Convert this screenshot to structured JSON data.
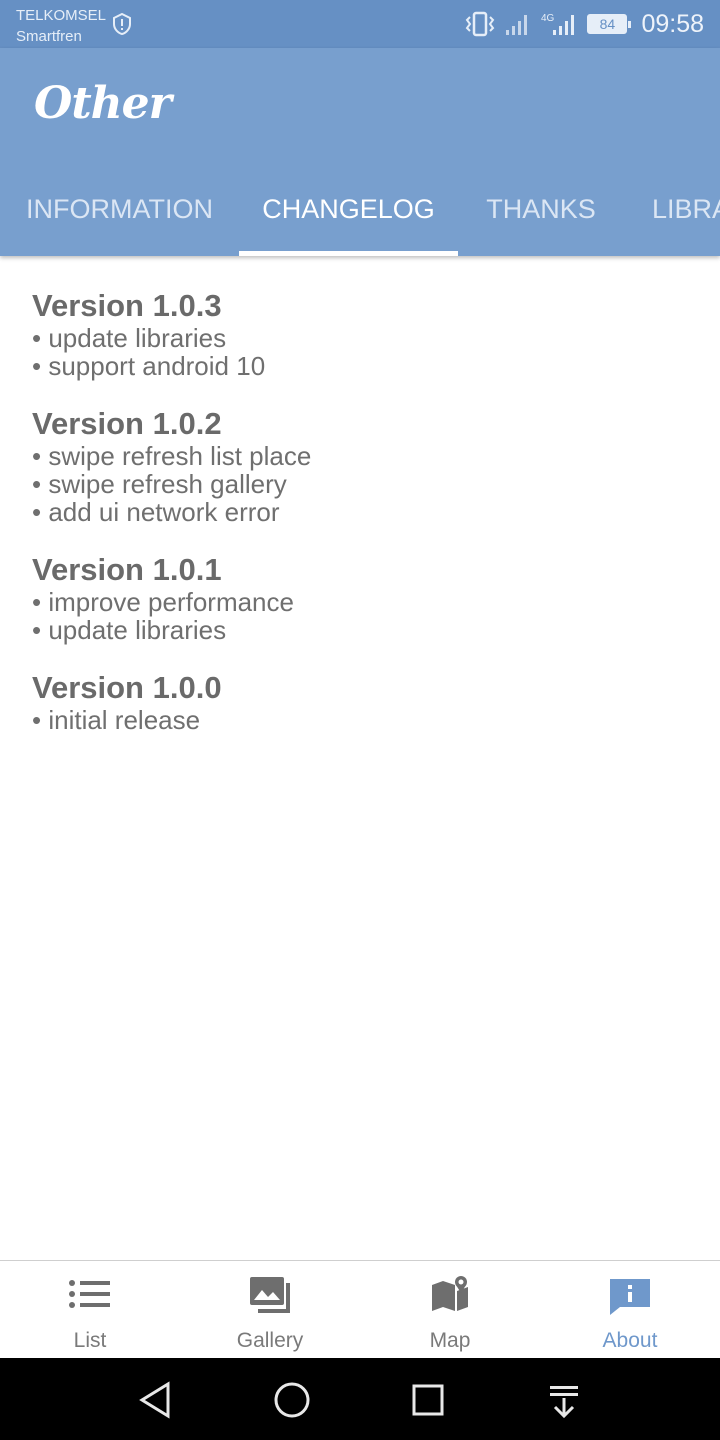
{
  "status_bar": {
    "carrier_1": "TELKOMSEL",
    "carrier_2": "Smartfren",
    "network": "4G",
    "battery": "84",
    "time": "09:58"
  },
  "app_bar": {
    "title": "Other",
    "tabs": [
      {
        "label": "INFORMATION",
        "active": false
      },
      {
        "label": "CHANGELOG",
        "active": true
      },
      {
        "label": "THANKS",
        "active": false
      },
      {
        "label": "LIBRA",
        "active": false
      }
    ]
  },
  "changelog": [
    {
      "version": "Version 1.0.3",
      "notes": [
        "• update libraries",
        "• support android 10"
      ]
    },
    {
      "version": "Version 1.0.2",
      "notes": [
        "• swipe refresh list place",
        "• swipe refresh gallery",
        "• add ui network error"
      ]
    },
    {
      "version": "Version 1.0.1",
      "notes": [
        "• improve performance",
        "• update libraries"
      ]
    },
    {
      "version": "Version 1.0.0",
      "notes": [
        "• initial release"
      ]
    }
  ],
  "bottom_nav": {
    "items": [
      {
        "label": "List",
        "icon": "list-icon",
        "active": false
      },
      {
        "label": "Gallery",
        "icon": "gallery-icon",
        "active": false
      },
      {
        "label": "Map",
        "icon": "map-icon",
        "active": false
      },
      {
        "label": "About",
        "icon": "info-chat-icon",
        "active": true
      }
    ]
  },
  "colors": {
    "status_bar": "#6690c4",
    "app_bar": "#789fce",
    "accent": "#6f98cb",
    "text": "#6f6f6f"
  }
}
